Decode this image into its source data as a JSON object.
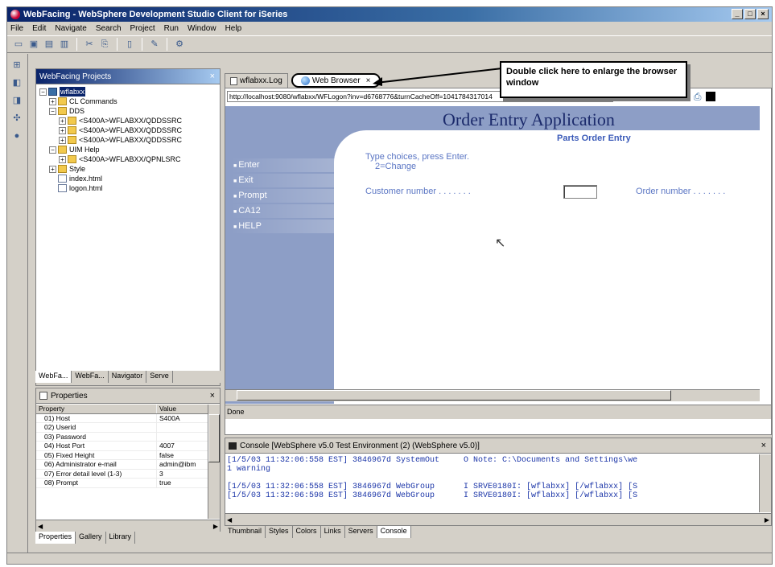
{
  "window": {
    "title": "WebFacing - WebSphere Development Studio Client for iSeries",
    "controls": [
      "_",
      "□",
      "×"
    ]
  },
  "menu": [
    "File",
    "Edit",
    "Navigate",
    "Search",
    "Project",
    "Run",
    "Window",
    "Help"
  ],
  "projects_panel": {
    "title": "WebFacing Projects",
    "tree": [
      {
        "label": "wflabxx",
        "depth": 0,
        "exp": "−",
        "icon": "proj",
        "selected": true
      },
      {
        "label": "CL Commands",
        "depth": 1,
        "exp": "+",
        "icon": "folder"
      },
      {
        "label": "DDS",
        "depth": 1,
        "exp": "−",
        "icon": "folder"
      },
      {
        "label": "<S400A>WFLABXX/QDDSSRC",
        "depth": 2,
        "exp": "+",
        "icon": "folder"
      },
      {
        "label": "<S400A>WFLABXX/QDDSSRC",
        "depth": 2,
        "exp": "+",
        "icon": "folder"
      },
      {
        "label": "<S400A>WFLABXX/QDDSSRC",
        "depth": 2,
        "exp": "+",
        "icon": "folder"
      },
      {
        "label": "UIM Help",
        "depth": 1,
        "exp": "−",
        "icon": "folder"
      },
      {
        "label": "<S400A>WFLABXX/QPNLSRC",
        "depth": 2,
        "exp": "+",
        "icon": "folder"
      },
      {
        "label": "Style",
        "depth": 1,
        "exp": "+",
        "icon": "folder"
      },
      {
        "label": "index.html",
        "depth": 1,
        "exp": "",
        "icon": "file"
      },
      {
        "label": "logon.html",
        "depth": 1,
        "exp": "",
        "icon": "file"
      }
    ],
    "tabs": [
      "WebFa...",
      "WebFa...",
      "Navigator",
      "Serve"
    ]
  },
  "properties_panel": {
    "title": "Properties",
    "columns": [
      "Property",
      "Value"
    ],
    "rows": [
      [
        "01) Host",
        "S400A"
      ],
      [
        "02) Userid",
        ""
      ],
      [
        "03) Password",
        ""
      ],
      [
        "04) Host Port",
        "4007"
      ],
      [
        "05) Fixed Height",
        "false"
      ],
      [
        "06) Administrator e-mail",
        "admin@ibm"
      ],
      [
        "07) Error detail level (1-3)",
        "3"
      ],
      [
        "08) Prompt",
        "true"
      ]
    ],
    "tabs": [
      "Properties",
      "Gallery",
      "Library"
    ]
  },
  "editor_tabs": [
    {
      "label": "wflabxx.Log",
      "active": false
    },
    {
      "label": "Web Browser",
      "active": true
    }
  ],
  "callout": "Double click here to enlarge the browser window",
  "browser": {
    "url": "http://localhost:9080/wflabxx/WFLogon?inv=d6768776&turnCacheOff=1041784317014",
    "app_title": "Order Entry Application",
    "subtitle": "Parts Order Entry",
    "instruction_line1": "Type choices, press Enter.",
    "instruction_line2": "2=Change",
    "customer_label": "Customer number . . . . . . .",
    "order_label": "Order number . . . . . . .",
    "function_keys": [
      "Enter",
      "Exit",
      "Prompt",
      "CA12",
      "HELP"
    ],
    "status": "Done"
  },
  "console": {
    "title": "Console [WebSphere v5.0 Test Environment (2) (WebSphere v5.0)]",
    "lines": [
      "[1/5/03 11:32:06:558 EST] 3846967d SystemOut     O Note: C:\\Documents and Settings\\we",
      "1 warning",
      "",
      "[1/5/03 11:32:06:558 EST] 3846967d WebGroup      I SRVE0180I: [wflabxx] [/wflabxx] [S",
      "[1/5/03 11:32:06:598 EST] 3846967d WebGroup      I SRVE0180I: [wflabxx] [/wflabxx] [S"
    ],
    "tabs": [
      "Thumbnail",
      "Styles",
      "Colors",
      "Links",
      "Servers",
      "Console"
    ]
  }
}
